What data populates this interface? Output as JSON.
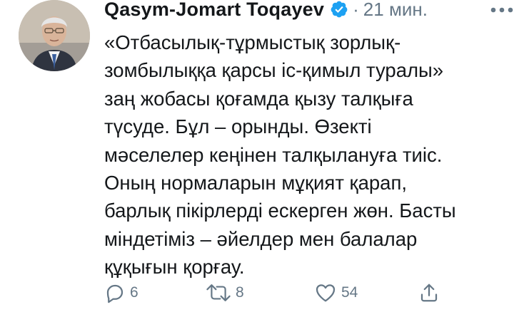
{
  "tweet": {
    "author_name": "Qasym-Jomart Toqayev",
    "separator": "·",
    "timestamp": "21 мин.",
    "body_lines": [
      "«Отбасылық-тұрмыстық зорлық-",
      "зомбылыққа қарсы іс-қимыл туралы»",
      "заң жобасы қоғамда қызу талқыға",
      "түсуде. Бұл – орынды. Өзекті",
      "мәселелер кеңінен талқылануға тиіс.",
      "Оның нормаларын мұқият қарап,",
      "барлық пікірлерді ескерген жөн. Басты",
      "міндетіміз – әйелдер мен балалар",
      "құқығын қорғау."
    ],
    "actions": {
      "replies": "6",
      "retweets": "8",
      "likes": "54"
    }
  },
  "icons": {
    "verified": "verified-badge-icon",
    "more": "more-options-icon",
    "reply": "reply-icon",
    "retweet": "retweet-icon",
    "like": "heart-icon",
    "share": "share-icon"
  },
  "colors": {
    "verified_blue": "#1da1f2",
    "secondary_text": "#657786",
    "primary_text": "#14171a"
  }
}
